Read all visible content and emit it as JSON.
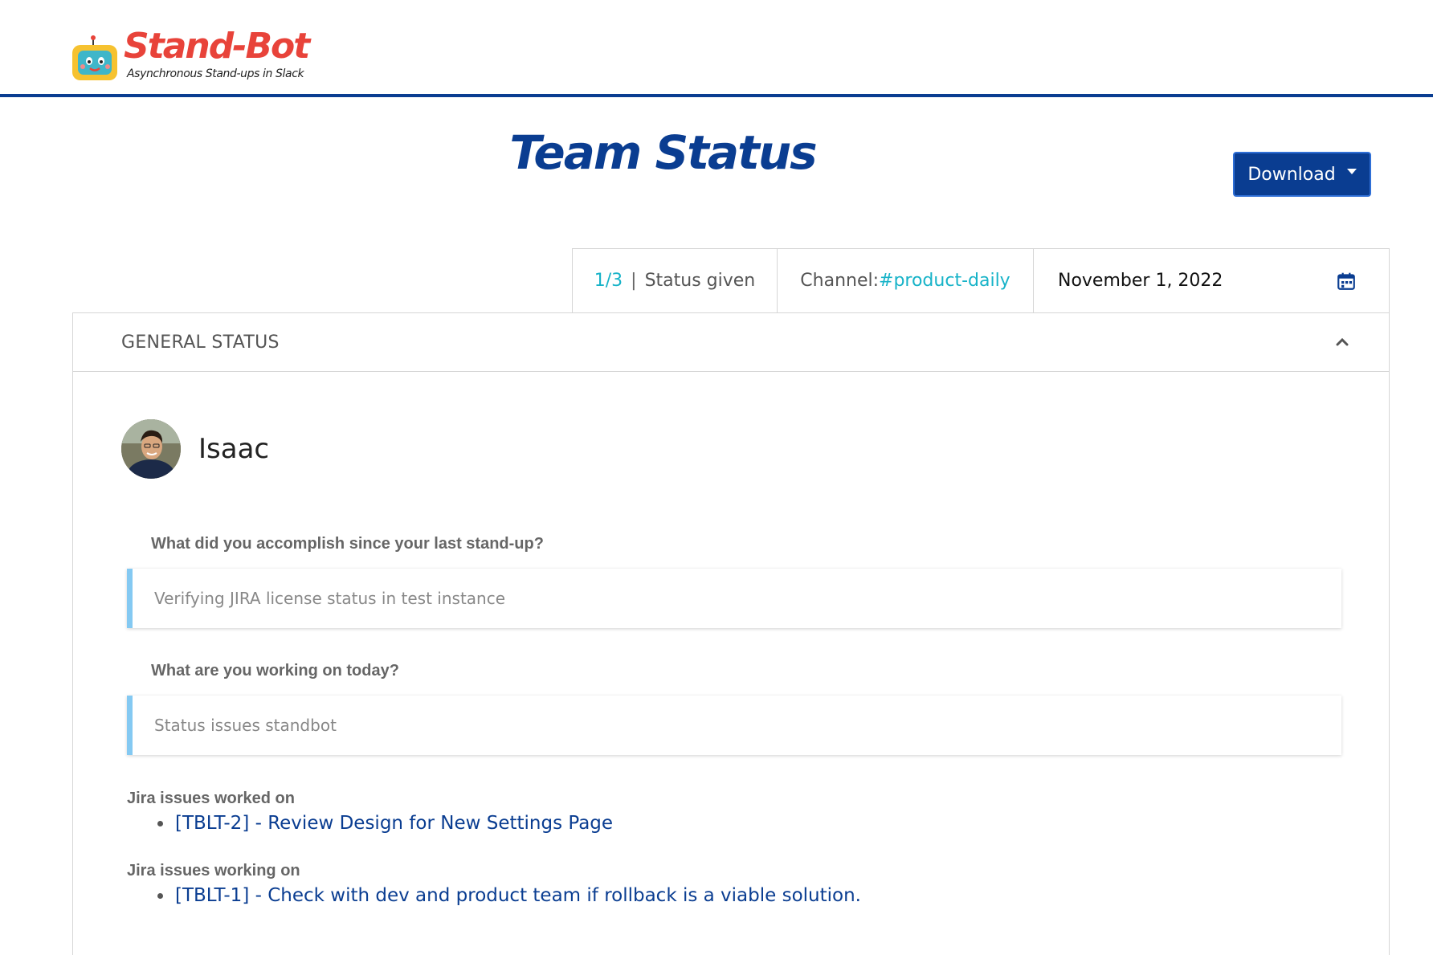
{
  "brand": {
    "title": "Stand-Bot",
    "tagline": "Asynchronous Stand-ups in Slack"
  },
  "page": {
    "title": "Team Status"
  },
  "toolbar": {
    "download_label": "Download"
  },
  "stats": {
    "given_count": "1/3",
    "given_label": "Status given",
    "channel_label": "Channel:",
    "channel_name": "#product-daily",
    "date": "November 1, 2022"
  },
  "panel": {
    "title": "GENERAL STATUS"
  },
  "user": {
    "name": "Isaac"
  },
  "questions": [
    {
      "label": "What did you accomplish since your last stand-up?",
      "answer": "Verifying JIRA license status in test instance"
    },
    {
      "label": "What are you working on today?",
      "answer": "Status issues standbot"
    }
  ],
  "jira": {
    "worked_on_label": "Jira issues worked on",
    "worked_on": [
      "[TBLT-2] - Review Design for New Settings Page"
    ],
    "working_on_label": "Jira issues working on",
    "working_on": [
      "[TBLT-1] - Check with dev and product team if rollback is a viable solution."
    ]
  },
  "colors": {
    "brand_blue": "#0a3d91",
    "accent_teal": "#17b3c8",
    "logo_red": "#e8433a",
    "answer_border": "#84c9f2"
  }
}
